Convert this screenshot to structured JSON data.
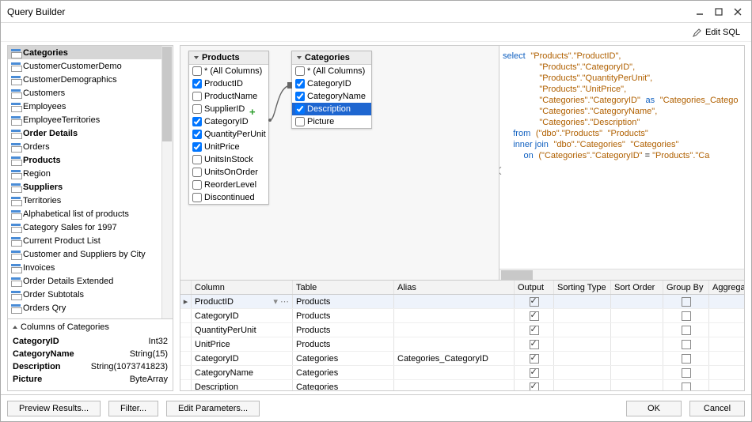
{
  "titlebar": {
    "title": "Query Builder"
  },
  "toolbar": {
    "edit_sql": "Edit SQL"
  },
  "left": {
    "tables": [
      "Categories",
      "CustomerCustomerDemo",
      "CustomerDemographics",
      "Customers",
      "Employees",
      "EmployeeTerritories",
      "Order Details",
      "Orders",
      "Products",
      "Region",
      "Suppliers",
      "Territories",
      "Alphabetical list of products",
      "Category Sales for 1997",
      "Current Product List",
      "Customer and Suppliers by City",
      "Invoices",
      "Order Details Extended",
      "Order Subtotals",
      "Orders Qry"
    ],
    "bold_tables": [
      "Categories",
      "Order Details",
      "Products",
      "Suppliers"
    ],
    "selected_table": "Categories",
    "columns_of_label": "Columns of Categories",
    "columns": [
      {
        "name": "CategoryID",
        "type": "Int32"
      },
      {
        "name": "CategoryName",
        "type": "String(15)"
      },
      {
        "name": "Description",
        "type": "String(1073741823)"
      },
      {
        "name": "Picture",
        "type": "ByteArray"
      }
    ]
  },
  "diagram": {
    "products": {
      "title": "Products",
      "fields": [
        {
          "label": "* (All Columns)",
          "checked": false
        },
        {
          "label": "ProductID",
          "checked": true
        },
        {
          "label": "ProductName",
          "checked": false
        },
        {
          "label": "SupplierID",
          "checked": false
        },
        {
          "label": "CategoryID",
          "checked": true
        },
        {
          "label": "QuantityPerUnit",
          "checked": true
        },
        {
          "label": "UnitPrice",
          "checked": true
        },
        {
          "label": "UnitsInStock",
          "checked": false
        },
        {
          "label": "UnitsOnOrder",
          "checked": false
        },
        {
          "label": "ReorderLevel",
          "checked": false
        },
        {
          "label": "Discontinued",
          "checked": false
        }
      ]
    },
    "categories": {
      "title": "Categories",
      "fields": [
        {
          "label": "* (All Columns)",
          "checked": false
        },
        {
          "label": "CategoryID",
          "checked": true
        },
        {
          "label": "CategoryName",
          "checked": true
        },
        {
          "label": "Description",
          "checked": true,
          "selected": true
        },
        {
          "label": "Picture",
          "checked": false
        }
      ]
    }
  },
  "sql": {
    "select": "select",
    "from": "from",
    "ij": "inner join",
    "on": "on",
    "as": "as",
    "lines": {
      "l1": "\"Products\".\"ProductID\",",
      "l2": "\"Products\".\"CategoryID\",",
      "l3": "\"Products\".\"QuantityPerUnit\",",
      "l4": "\"Products\".\"UnitPrice\",",
      "l5a": "\"Categories\".\"CategoryID\"",
      "l5b": "\"Categories_Catego",
      "l6": "\"Categories\".\"CategoryName\",",
      "l7": "\"Categories\".\"Description\"",
      "l8a": "(\"dbo\".\"Products\"",
      "l8b": "\"Products\"",
      "l9a": "\"dbo\".\"Categories\"",
      "l9b": "\"Categories\"",
      "l10a": "(\"Categories\".\"CategoryID\"",
      "l10b": " = ",
      "l10c": "\"Products\".\"Ca"
    }
  },
  "grid": {
    "headers": [
      "Column",
      "Table",
      "Alias",
      "Output",
      "Sorting Type",
      "Sort Order",
      "Group By",
      "Aggregate"
    ],
    "rows": [
      {
        "col": "ProductID",
        "table": "Products",
        "alias": "",
        "out": true,
        "gb": false,
        "sel": true,
        "indic": true,
        "dd": true
      },
      {
        "col": "CategoryID",
        "table": "Products",
        "alias": "",
        "out": true,
        "gb": false
      },
      {
        "col": "QuantityPerUnit",
        "table": "Products",
        "alias": "",
        "out": true,
        "gb": false
      },
      {
        "col": "UnitPrice",
        "table": "Products",
        "alias": "",
        "out": true,
        "gb": false
      },
      {
        "col": "CategoryID",
        "table": "Categories",
        "alias": "Categories_CategoryID",
        "out": true,
        "gb": false
      },
      {
        "col": "CategoryName",
        "table": "Categories",
        "alias": "",
        "out": true,
        "gb": false
      },
      {
        "col": "Description",
        "table": "Categories",
        "alias": "",
        "out": true,
        "gb": false
      }
    ]
  },
  "buttons": {
    "preview": "Preview Results...",
    "filter": "Filter...",
    "params": "Edit Parameters...",
    "ok": "OK",
    "cancel": "Cancel"
  }
}
